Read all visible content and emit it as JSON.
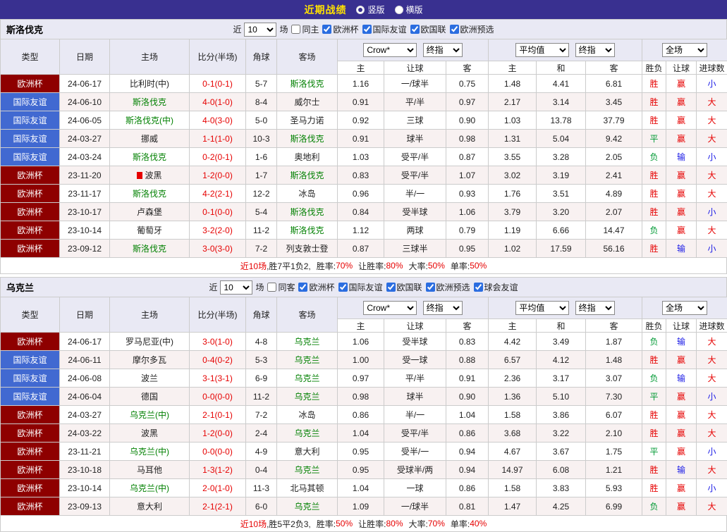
{
  "top_bar": {
    "title": "近期战绩",
    "layout_options": [
      {
        "label": "竖版",
        "selected": true
      },
      {
        "label": "横版",
        "selected": false
      }
    ]
  },
  "labels": {
    "recent": "近",
    "games": "场"
  },
  "controls": {
    "odds_source": "Crow*",
    "odds_final": "终指",
    "avg_source": "平均值",
    "avg_final": "终指",
    "scope": "全场"
  },
  "columns": {
    "type": "类型",
    "date": "日期",
    "home": "主场",
    "score": "比分(半场)",
    "corner": "角球",
    "away": "客场",
    "odds_home": "主",
    "handicap": "让球",
    "odds_away": "客",
    "avg_home": "主",
    "avg_draw": "和",
    "avg_away": "客",
    "wdl": "胜负",
    "handicap_result": "让球",
    "goals": "进球数"
  },
  "colors": {
    "topbar_bg": "#393090",
    "title_yellow": "#ffe100",
    "euro_cup_bg": "#8e0000",
    "friendly_bg": "#4169d1",
    "team_highlight": "#008000",
    "win_red": "#e60000",
    "draw_loss_green": "#009933",
    "under_blue": "#1a1ae6"
  },
  "sections": [
    {
      "team": "斯洛伐克",
      "filter": {
        "count": "10",
        "same_label": "同主",
        "same_checked": false,
        "competitions": [
          {
            "label": "欧洲杯",
            "checked": true
          },
          {
            "label": "国际友谊",
            "checked": true
          },
          {
            "label": "欧国联",
            "checked": true
          },
          {
            "label": "欧洲预选",
            "checked": true
          }
        ]
      },
      "rows": [
        {
          "type": "欧洲杯",
          "date": "24-06-17",
          "home": "比利时(中)",
          "score": "0-1(0-1)",
          "corner": "5-7",
          "away": "斯洛伐克",
          "o_home": "1.16",
          "handicap": "一/球半",
          "o_away": "0.75",
          "a_home": "1.48",
          "a_draw": "4.41",
          "a_away": "6.81",
          "wdl": "胜",
          "hcp_res": "赢",
          "goals": "小"
        },
        {
          "type": "国际友谊",
          "date": "24-06-10",
          "home": "斯洛伐克",
          "score": "4-0(1-0)",
          "corner": "8-4",
          "away": "威尔士",
          "o_home": "0.91",
          "handicap": "平/半",
          "o_away": "0.97",
          "a_home": "2.17",
          "a_draw": "3.14",
          "a_away": "3.45",
          "wdl": "胜",
          "hcp_res": "赢",
          "goals": "大"
        },
        {
          "type": "国际友谊",
          "date": "24-06-05",
          "home": "斯洛伐克(中)",
          "score": "4-0(3-0)",
          "corner": "5-0",
          "away": "圣马力诺",
          "o_home": "0.92",
          "handicap": "三球",
          "o_away": "0.90",
          "a_home": "1.03",
          "a_draw": "13.78",
          "a_away": "37.79",
          "wdl": "胜",
          "hcp_res": "赢",
          "goals": "大"
        },
        {
          "type": "国际友谊",
          "date": "24-03-27",
          "home": "挪威",
          "score": "1-1(1-0)",
          "corner": "10-3",
          "away": "斯洛伐克",
          "o_home": "0.91",
          "handicap": "球半",
          "o_away": "0.98",
          "a_home": "1.31",
          "a_draw": "5.04",
          "a_away": "9.42",
          "wdl": "平",
          "hcp_res": "赢",
          "goals": "大"
        },
        {
          "type": "国际友谊",
          "date": "24-03-24",
          "home": "斯洛伐克",
          "score": "0-2(0-1)",
          "corner": "1-6",
          "away": "奥地利",
          "o_home": "1.03",
          "handicap": "受平/半",
          "o_away": "0.87",
          "a_home": "3.55",
          "a_draw": "3.28",
          "a_away": "2.05",
          "wdl": "负",
          "hcp_res": "输",
          "goals": "小"
        },
        {
          "type": "欧洲杯",
          "date": "23-11-20",
          "home": "波黑",
          "home_badge": true,
          "score": "1-2(0-0)",
          "corner": "1-7",
          "away": "斯洛伐克",
          "o_home": "0.83",
          "handicap": "受平/半",
          "o_away": "1.07",
          "a_home": "3.02",
          "a_draw": "3.19",
          "a_away": "2.41",
          "wdl": "胜",
          "hcp_res": "赢",
          "goals": "大"
        },
        {
          "type": "欧洲杯",
          "date": "23-11-17",
          "home": "斯洛伐克",
          "score": "4-2(2-1)",
          "corner": "12-2",
          "away": "冰岛",
          "o_home": "0.96",
          "handicap": "半/一",
          "o_away": "0.93",
          "a_home": "1.76",
          "a_draw": "3.51",
          "a_away": "4.89",
          "wdl": "胜",
          "hcp_res": "赢",
          "goals": "大"
        },
        {
          "type": "欧洲杯",
          "date": "23-10-17",
          "home": "卢森堡",
          "score": "0-1(0-0)",
          "corner": "5-4",
          "away": "斯洛伐克",
          "o_home": "0.84",
          "handicap": "受半球",
          "o_away": "1.06",
          "a_home": "3.79",
          "a_draw": "3.20",
          "a_away": "2.07",
          "wdl": "胜",
          "hcp_res": "赢",
          "goals": "小"
        },
        {
          "type": "欧洲杯",
          "date": "23-10-14",
          "home": "葡萄牙",
          "score": "3-2(2-0)",
          "corner": "11-2",
          "away": "斯洛伐克",
          "o_home": "1.12",
          "handicap": "两球",
          "o_away": "0.79",
          "a_home": "1.19",
          "a_draw": "6.66",
          "a_away": "14.47",
          "wdl": "负",
          "hcp_res": "赢",
          "goals": "大"
        },
        {
          "type": "欧洲杯",
          "date": "23-09-12",
          "home": "斯洛伐克",
          "score": "3-0(3-0)",
          "corner": "7-2",
          "away": "列支敦士登",
          "o_home": "0.87",
          "handicap": "三球半",
          "o_away": "0.95",
          "a_home": "1.02",
          "a_draw": "17.59",
          "a_away": "56.16",
          "wdl": "胜",
          "hcp_res": "输",
          "goals": "小"
        }
      ],
      "summary": {
        "recent": "近10场",
        "record": ",胜7平1负2,",
        "stats": [
          {
            "label": "胜率:",
            "value": "70%"
          },
          {
            "label": "让胜率:",
            "value": "80%"
          },
          {
            "label": "大率:",
            "value": "50%"
          },
          {
            "label": "单率:",
            "value": "50%"
          }
        ]
      }
    },
    {
      "team": "乌克兰",
      "filter": {
        "count": "10",
        "same_label": "同客",
        "same_checked": false,
        "competitions": [
          {
            "label": "欧洲杯",
            "checked": true
          },
          {
            "label": "国际友谊",
            "checked": true
          },
          {
            "label": "欧国联",
            "checked": true
          },
          {
            "label": "欧洲预选",
            "checked": true
          },
          {
            "label": "球会友谊",
            "checked": true
          }
        ]
      },
      "rows": [
        {
          "type": "欧洲杯",
          "date": "24-06-17",
          "home": "罗马尼亚(中)",
          "score": "3-0(1-0)",
          "corner": "4-8",
          "away": "乌克兰",
          "o_home": "1.06",
          "handicap": "受半球",
          "o_away": "0.83",
          "a_home": "4.42",
          "a_draw": "3.49",
          "a_away": "1.87",
          "wdl": "负",
          "hcp_res": "输",
          "goals": "大"
        },
        {
          "type": "国际友谊",
          "date": "24-06-11",
          "home": "摩尔多瓦",
          "score": "0-4(0-2)",
          "corner": "5-3",
          "away": "乌克兰",
          "o_home": "1.00",
          "handicap": "受一球",
          "o_away": "0.88",
          "a_home": "6.57",
          "a_draw": "4.12",
          "a_away": "1.48",
          "wdl": "胜",
          "hcp_res": "赢",
          "goals": "大"
        },
        {
          "type": "国际友谊",
          "date": "24-06-08",
          "home": "波兰",
          "score": "3-1(3-1)",
          "corner": "6-9",
          "away": "乌克兰",
          "o_home": "0.97",
          "handicap": "平/半",
          "o_away": "0.91",
          "a_home": "2.36",
          "a_draw": "3.17",
          "a_away": "3.07",
          "wdl": "负",
          "hcp_res": "输",
          "goals": "大"
        },
        {
          "type": "国际友谊",
          "date": "24-06-04",
          "home": "德国",
          "score": "0-0(0-0)",
          "corner": "11-2",
          "away": "乌克兰",
          "o_home": "0.98",
          "handicap": "球半",
          "o_away": "0.90",
          "a_home": "1.36",
          "a_draw": "5.10",
          "a_away": "7.30",
          "wdl": "平",
          "hcp_res": "赢",
          "goals": "小"
        },
        {
          "type": "欧洲杯",
          "date": "24-03-27",
          "home": "乌克兰(中)",
          "score": "2-1(0-1)",
          "corner": "7-2",
          "away": "冰岛",
          "o_home": "0.86",
          "handicap": "半/一",
          "o_away": "1.04",
          "a_home": "1.58",
          "a_draw": "3.86",
          "a_away": "6.07",
          "wdl": "胜",
          "hcp_res": "赢",
          "goals": "大"
        },
        {
          "type": "欧洲杯",
          "date": "24-03-22",
          "home": "波黑",
          "score": "1-2(0-0)",
          "corner": "2-4",
          "away": "乌克兰",
          "o_home": "1.04",
          "handicap": "受平/半",
          "o_away": "0.86",
          "a_home": "3.68",
          "a_draw": "3.22",
          "a_away": "2.10",
          "wdl": "胜",
          "hcp_res": "赢",
          "goals": "大"
        },
        {
          "type": "欧洲杯",
          "date": "23-11-21",
          "home": "乌克兰(中)",
          "score": "0-0(0-0)",
          "corner": "4-9",
          "away": "意大利",
          "o_home": "0.95",
          "handicap": "受半/一",
          "o_away": "0.94",
          "a_home": "4.67",
          "a_draw": "3.67",
          "a_away": "1.75",
          "wdl": "平",
          "hcp_res": "赢",
          "goals": "小"
        },
        {
          "type": "欧洲杯",
          "date": "23-10-18",
          "home": "马耳他",
          "score": "1-3(1-2)",
          "corner": "0-4",
          "away": "乌克兰",
          "o_home": "0.95",
          "handicap": "受球半/两",
          "o_away": "0.94",
          "a_home": "14.97",
          "a_draw": "6.08",
          "a_away": "1.21",
          "wdl": "胜",
          "hcp_res": "输",
          "goals": "大"
        },
        {
          "type": "欧洲杯",
          "date": "23-10-14",
          "home": "乌克兰(中)",
          "score": "2-0(1-0)",
          "corner": "11-3",
          "away": "北马其顿",
          "o_home": "1.04",
          "handicap": "一球",
          "o_away": "0.86",
          "a_home": "1.58",
          "a_draw": "3.83",
          "a_away": "5.93",
          "wdl": "胜",
          "hcp_res": "赢",
          "goals": "小"
        },
        {
          "type": "欧洲杯",
          "date": "23-09-13",
          "home": "意大利",
          "score": "2-1(2-1)",
          "corner": "6-0",
          "away": "乌克兰",
          "o_home": "1.09",
          "handicap": "一/球半",
          "o_away": "0.81",
          "a_home": "1.47",
          "a_draw": "4.25",
          "a_away": "6.99",
          "wdl": "负",
          "hcp_res": "赢",
          "goals": "大"
        }
      ],
      "summary": {
        "recent": "近10场",
        "record": ",胜5平2负3,",
        "stats": [
          {
            "label": "胜率:",
            "value": "50%"
          },
          {
            "label": "让胜率:",
            "value": "80%"
          },
          {
            "label": "大率:",
            "value": "70%"
          },
          {
            "label": "单率:",
            "value": "40%"
          }
        ]
      }
    }
  ]
}
